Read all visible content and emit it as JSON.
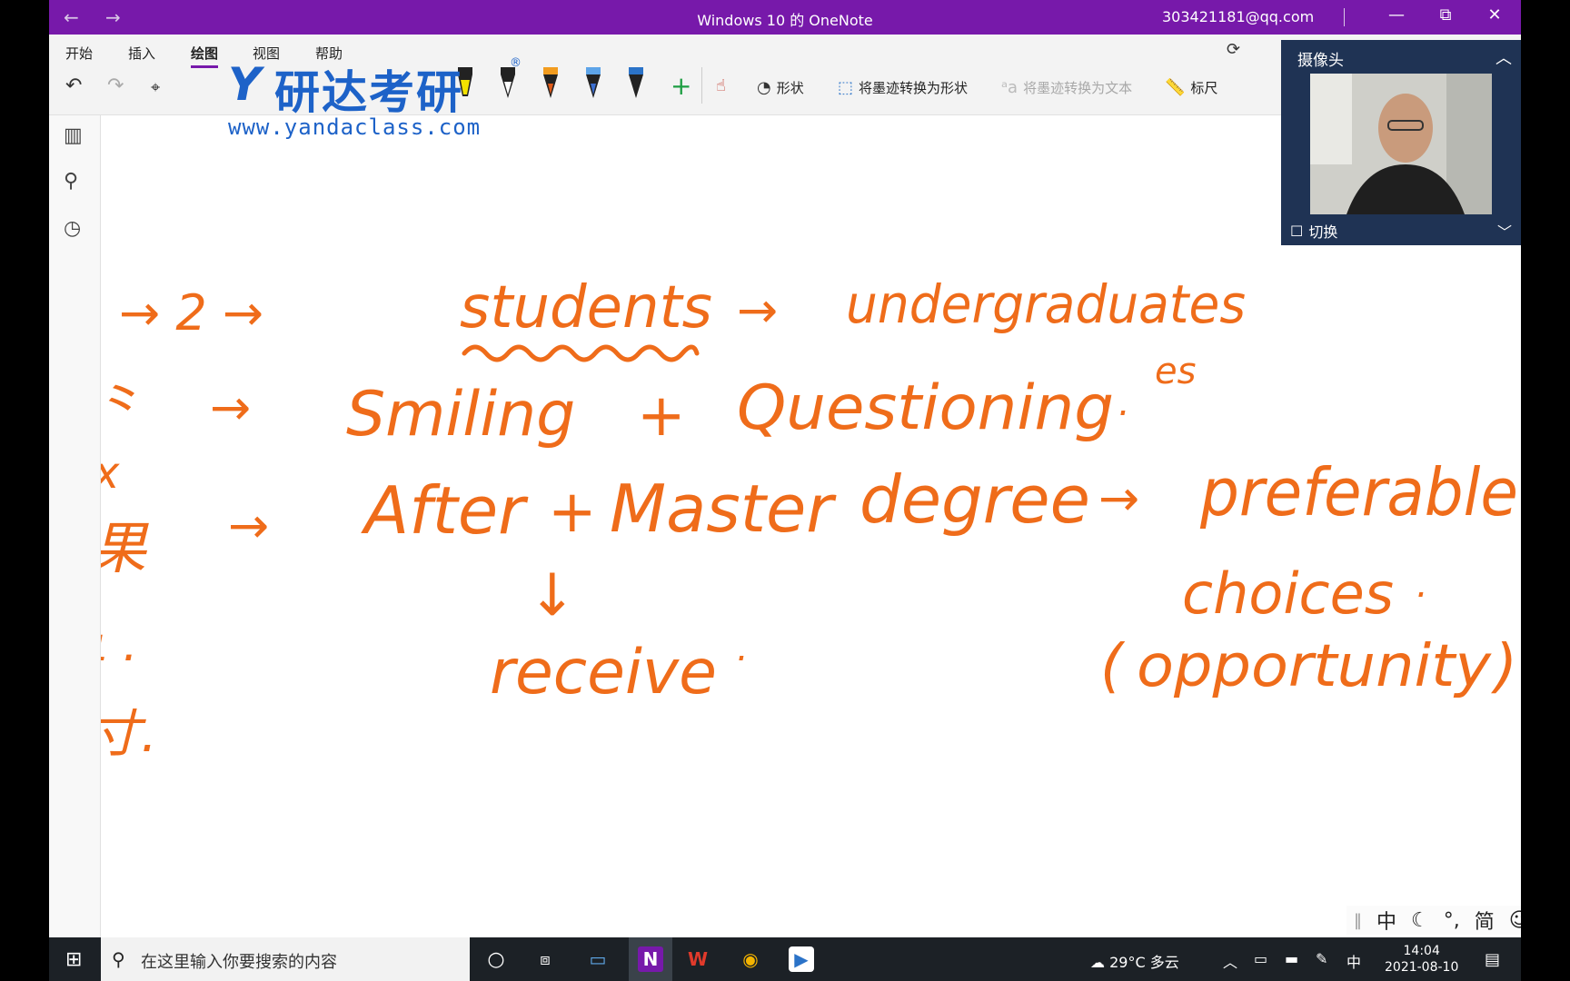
{
  "window": {
    "title": "Windows 10 的 OneNote",
    "account": "303421181@qq.com",
    "back": "←",
    "forward": "→",
    "minimize": "—",
    "restore": "⧉",
    "close": "✕"
  },
  "ribbon": {
    "tabs": [
      "开始",
      "插入",
      "绘图",
      "视图",
      "帮助"
    ],
    "active_tab": "绘图",
    "tools": {
      "shapes": "形状",
      "ink_to_shape": "将墨迹转换为形状",
      "ink_to_text": "将墨迹转换为文本",
      "ruler": "标尺"
    },
    "add_pen": "+"
  },
  "watermark": {
    "brand": "研达考研",
    "logo_letter": "Y",
    "registered": "®",
    "url": "www.yandaclass.com"
  },
  "ink": {
    "color": "#ef6c1a",
    "line1": [
      "→ 2 →",
      "students",
      "→",
      "undergraduates"
    ],
    "line2": [
      "→",
      "Smiling",
      "+",
      "Questioning",
      "."
    ],
    "line3": [
      "→",
      "After",
      "+",
      "Master",
      "degree",
      "→",
      "preferable"
    ],
    "line4": [
      "↓",
      "receive",
      ".",
      "choices",
      "."
    ],
    "line5": [
      "(",
      "opportunity",
      ")"
    ],
    "suffix": "es"
  },
  "camera": {
    "title": "摄像头",
    "switch": "切换"
  },
  "ime": [
    "中",
    "☾",
    "°,",
    "简",
    "☺",
    "⚙"
  ],
  "taskbar": {
    "search_placeholder": "在这里输入你要搜索的内容",
    "weather": "29°C 多云",
    "input_mode": "中",
    "time": "14:04",
    "date": "2021-08-10"
  }
}
